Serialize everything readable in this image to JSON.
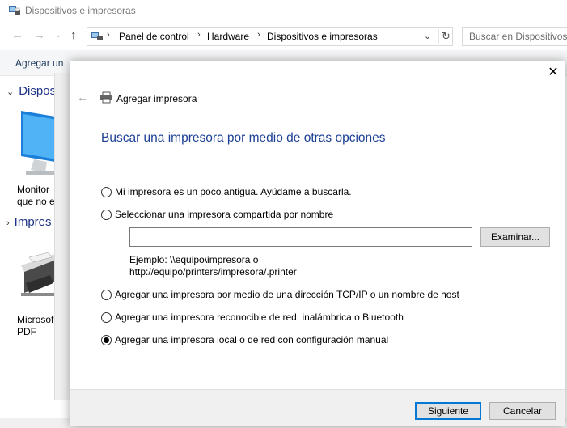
{
  "window": {
    "title": "Dispositivos e impresoras"
  },
  "address_bar": {
    "breadcrumbs": [
      "Panel de control",
      "Hardware",
      "Dispositivos e impresoras"
    ],
    "search_placeholder": "Buscar en Dispositivos e i"
  },
  "toolbar": {
    "add_label": "Agregar un"
  },
  "content": {
    "groups": [
      {
        "label": "Disposi"
      },
      {
        "label": "Impres"
      }
    ],
    "devices": [
      {
        "line1": "Monitor",
        "line2": "que no e"
      },
      {
        "line1": "Microsof",
        "line2": "PDF"
      }
    ]
  },
  "dialog": {
    "caption": "Agregar impresora",
    "heading": "Buscar una impresora por medio de otras opciones",
    "options": [
      {
        "label": "Mi impresora es un poco antigua. Ayúdame a buscarla.",
        "checked": false
      },
      {
        "label": "Seleccionar una impresora compartida por nombre",
        "checked": false
      },
      {
        "label": "Agregar una impresora por medio de una dirección TCP/IP o un nombre de host",
        "checked": false
      },
      {
        "label": "Agregar una impresora reconocible de red, inalámbrica o Bluetooth",
        "checked": false
      },
      {
        "label": "Agregar una impresora local o de red con configuración manual",
        "checked": true
      }
    ],
    "shared_name_value": "",
    "browse_label": "Examinar...",
    "example_line1": "Ejemplo: \\\\equipo\\impresora o",
    "example_line2": "http://equipo/printers/impresora/.printer",
    "next_label": "Siguiente",
    "cancel_label": "Cancelar"
  },
  "colors": {
    "heading": "#1c3f94",
    "group_header": "#1e3287",
    "dialog_border": "#2b79d0",
    "primary_button_border": "#0078d7"
  }
}
